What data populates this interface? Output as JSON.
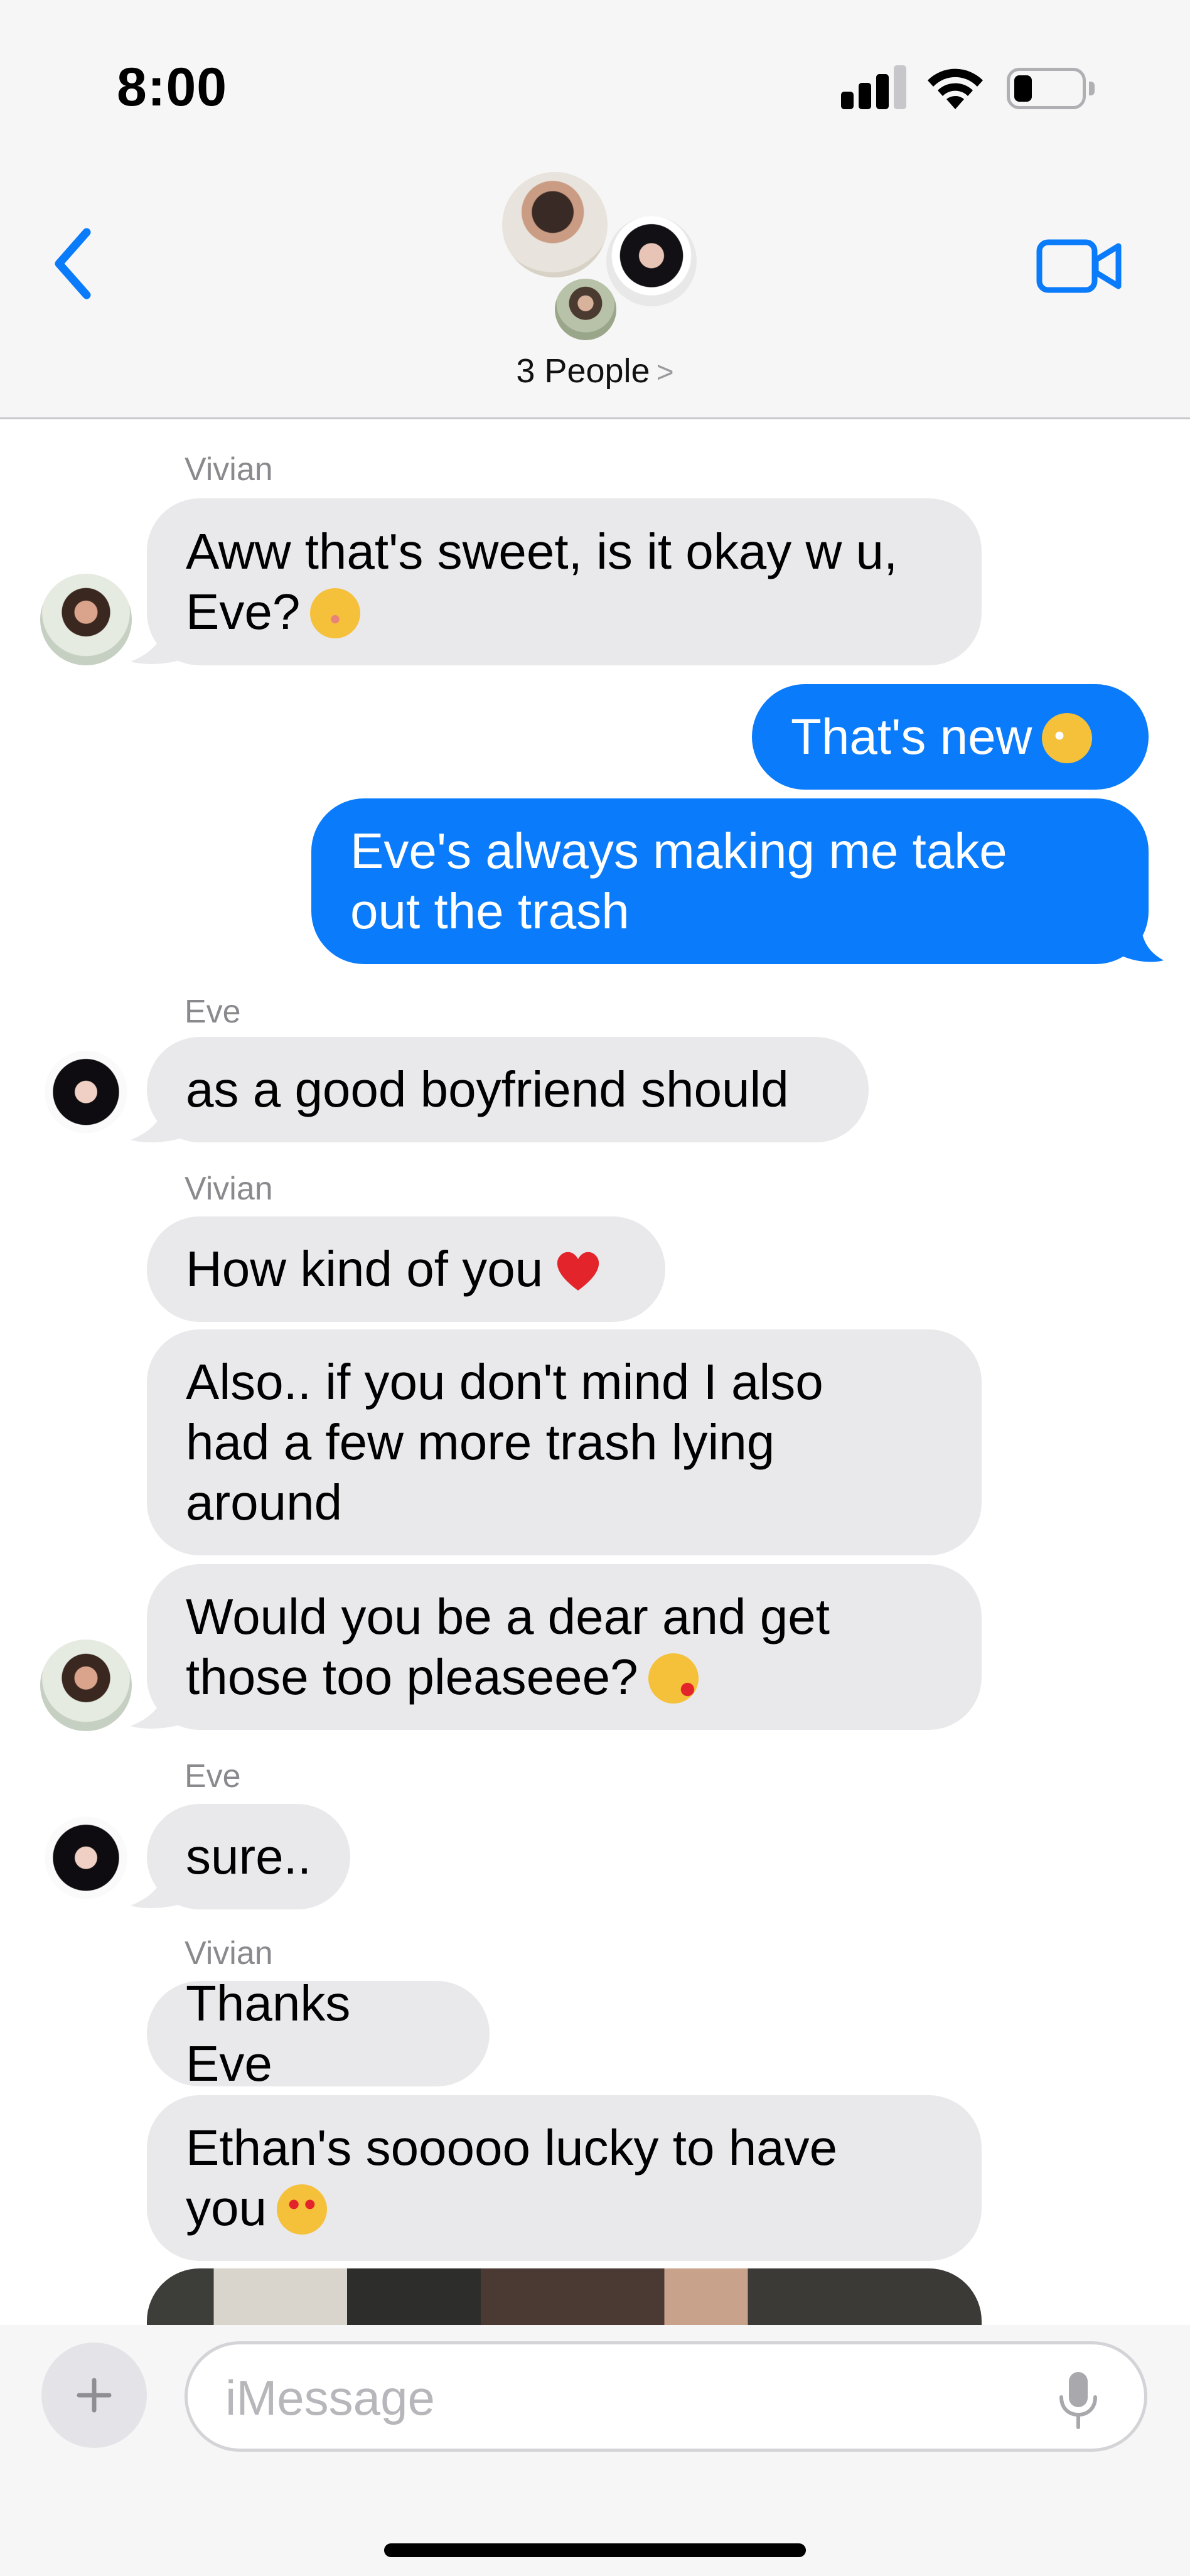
{
  "status_bar": {
    "time": "8:00",
    "icons": [
      "cellular-signal-icon",
      "wifi-icon",
      "battery-low-icon"
    ]
  },
  "header": {
    "back_icon": "chevron-left-icon",
    "title": "3 People",
    "title_chevron": ">",
    "video_icon": "video-camera-icon",
    "avatars": [
      "Vivian",
      "Eve",
      "Vivian-small"
    ]
  },
  "colors": {
    "accent": "#0A7BFA",
    "incoming_bubble": "#E9E9EB",
    "outgoing_bubble": "#0A7BFA",
    "header_bg": "#F6F6F6"
  },
  "messages": [
    {
      "sender": "Vivian",
      "text": "Aww that's sweet, is it okay w u,\nEve?",
      "emoji": "smiling-face-icon",
      "direction": "incoming"
    },
    {
      "text": "That's new",
      "emoji": "flushed-face-icon",
      "direction": "outgoing"
    },
    {
      "text": "Eve's always making me take\nout the trash",
      "direction": "outgoing"
    },
    {
      "sender": "Eve",
      "text": "as a good boyfriend should",
      "direction": "incoming"
    },
    {
      "sender": "Vivian",
      "text": "How kind of you",
      "emoji": "red-heart-icon",
      "direction": "incoming"
    },
    {
      "text": "Also.. if you don't mind I also\nhad a few more trash lying\naround",
      "direction": "incoming"
    },
    {
      "text": "Would you be a dear and get\nthose too pleaseee?",
      "emoji": "kissing-face-icon",
      "direction": "incoming"
    },
    {
      "sender": "Eve",
      "text": "sure..",
      "direction": "incoming"
    },
    {
      "sender": "Vivian",
      "text": "Thanks Eve",
      "direction": "incoming"
    },
    {
      "text": "Ethan's sooooo lucky to have\nyou",
      "emoji": "heart-eyes-face-icon",
      "direction": "incoming"
    }
  ],
  "composer": {
    "plus_icon": "plus-icon",
    "placeholder": "iMessage",
    "mic_icon": "microphone-icon"
  }
}
